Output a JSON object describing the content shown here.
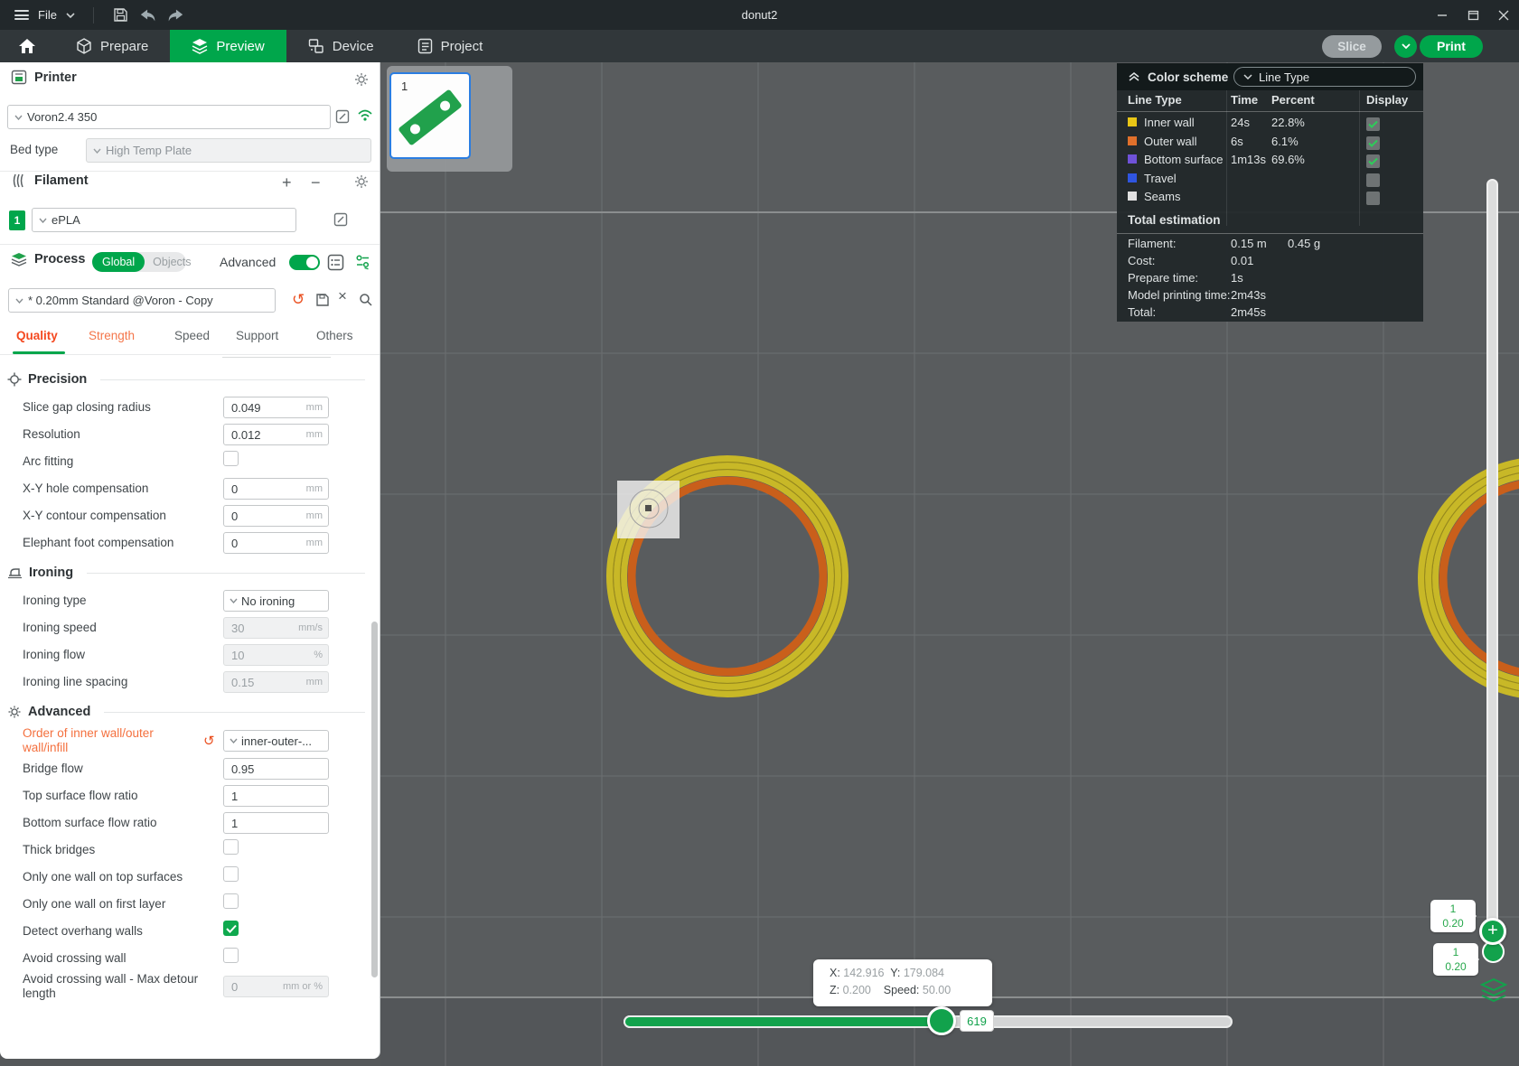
{
  "window": {
    "title": "donut2"
  },
  "menubar": {
    "file": "File"
  },
  "nav": {
    "tabs": [
      {
        "label": "Prepare"
      },
      {
        "label": "Preview",
        "active": true
      },
      {
        "label": "Device"
      },
      {
        "label": "Project"
      }
    ],
    "slice_label": "Slice",
    "print_label": "Print"
  },
  "printer": {
    "section": "Printer",
    "name": "Voron2.4 350",
    "bed_type_label": "Bed type",
    "bed_type": "High Temp Plate"
  },
  "filament": {
    "section": "Filament",
    "slot": "1",
    "name": "ePLA"
  },
  "process": {
    "section": "Process",
    "global": "Global",
    "objects": "Objects",
    "advanced": "Advanced",
    "preset": "* 0.20mm Standard @Voron - Copy",
    "tabs": [
      "Quality",
      "Strength",
      "Speed",
      "Support",
      "Others"
    ]
  },
  "settings": {
    "groups": [
      {
        "title": "Precision",
        "rows": [
          {
            "label": "Slice gap closing radius",
            "type": "input",
            "value": "0.049",
            "unit": "mm"
          },
          {
            "label": "Resolution",
            "type": "input",
            "value": "0.012",
            "unit": "mm"
          },
          {
            "label": "Arc fitting",
            "type": "checkbox",
            "checked": false
          },
          {
            "label": "X-Y hole compensation",
            "type": "input",
            "value": "0",
            "unit": "mm"
          },
          {
            "label": "X-Y contour compensation",
            "type": "input",
            "value": "0",
            "unit": "mm"
          },
          {
            "label": "Elephant foot compensation",
            "type": "input",
            "value": "0",
            "unit": "mm"
          }
        ]
      },
      {
        "title": "Ironing",
        "rows": [
          {
            "label": "Ironing type",
            "type": "select",
            "value": "No ironing"
          },
          {
            "label": "Ironing speed",
            "type": "input",
            "value": "30",
            "unit": "mm/s",
            "disabled": true
          },
          {
            "label": "Ironing flow",
            "type": "input",
            "value": "10",
            "unit": "%",
            "disabled": true
          },
          {
            "label": "Ironing line spacing",
            "type": "input",
            "value": "0.15",
            "unit": "mm",
            "disabled": true
          }
        ]
      },
      {
        "title": "Advanced",
        "rows": [
          {
            "label": "Order of inner wall/outer wall/infill",
            "type": "select",
            "value": "inner-outer-...",
            "modified": true
          },
          {
            "label": "Bridge flow",
            "type": "input",
            "value": "0.95"
          },
          {
            "label": "Top surface flow ratio",
            "type": "input",
            "value": "1"
          },
          {
            "label": "Bottom surface flow ratio",
            "type": "input",
            "value": "1"
          },
          {
            "label": "Thick bridges",
            "type": "checkbox",
            "checked": false
          },
          {
            "label": "Only one wall on top surfaces",
            "type": "checkbox",
            "checked": false
          },
          {
            "label": "Only one wall on first layer",
            "type": "checkbox",
            "checked": false
          },
          {
            "label": "Detect overhang walls",
            "type": "checkbox",
            "checked": true
          },
          {
            "label": "Avoid crossing wall",
            "type": "checkbox",
            "checked": false
          },
          {
            "label": "Avoid crossing wall - Max detour length",
            "type": "input",
            "value": "0",
            "unit": "mm or %",
            "disabled": true
          }
        ]
      }
    ]
  },
  "plate": {
    "number": "1"
  },
  "color_scheme": {
    "title": "Color scheme",
    "selector": "Line Type",
    "columns": [
      "Line Type",
      "Time",
      "Percent",
      "Display"
    ],
    "rows": [
      {
        "name": "Inner wall",
        "color": "#e9c616",
        "time": "24s",
        "percent": "22.8%",
        "display": true
      },
      {
        "name": "Outer wall",
        "color": "#e0702b",
        "time": "6s",
        "percent": "6.1%",
        "display": true
      },
      {
        "name": "Bottom surface",
        "color": "#6f52d8",
        "time": "1m13s",
        "percent": "69.6%",
        "display": true
      },
      {
        "name": "Travel",
        "color": "#2f55e0",
        "time": "",
        "percent": "",
        "display": false
      },
      {
        "name": "Seams",
        "color": "#e0e0e0",
        "time": "",
        "percent": "",
        "display": false
      }
    ]
  },
  "estimation": {
    "title": "Total estimation",
    "rows": [
      {
        "label": "Filament:",
        "value": "0.15 m",
        "value2": "0.45 g"
      },
      {
        "label": "Cost:",
        "value": "0.01",
        "value2": ""
      },
      {
        "label": "Prepare time:",
        "value": "1s",
        "value2": ""
      },
      {
        "label": "Model printing time:",
        "value": "2m43s",
        "value2": ""
      },
      {
        "label": "Total:",
        "value": "2m45s",
        "value2": ""
      }
    ]
  },
  "viewport_hud": {
    "tooltip": {
      "x_label": "X:",
      "x": "142.916",
      "y_label": "Y:",
      "y": "179.084",
      "z_label": "Z:",
      "z": "0.200",
      "speed_label": "Speed:",
      "speed": "50.00"
    },
    "hslider": {
      "value": "619"
    },
    "vslider": {
      "top_badge_layer": "1",
      "top_badge_height": "0.20",
      "bottom_badge_layer": "1",
      "bottom_badge_height": "0.20"
    }
  },
  "colors": {
    "accent_green": "#00a64b",
    "modified_orange": "#f4703e",
    "inner_wall": "#c8b827",
    "outer_wall": "#c95f1b"
  }
}
